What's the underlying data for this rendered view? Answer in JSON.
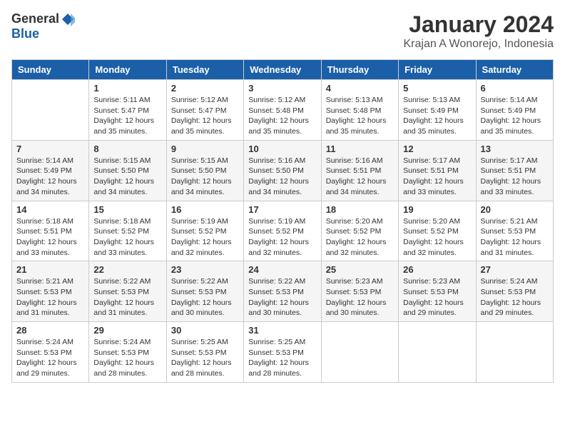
{
  "logo": {
    "general": "General",
    "blue": "Blue"
  },
  "title": "January 2024",
  "subtitle": "Krajan A Wonorejo, Indonesia",
  "days_header": [
    "Sunday",
    "Monday",
    "Tuesday",
    "Wednesday",
    "Thursday",
    "Friday",
    "Saturday"
  ],
  "weeks": [
    [
      {
        "day": "",
        "info": ""
      },
      {
        "day": "1",
        "info": "Sunrise: 5:11 AM\nSunset: 5:47 PM\nDaylight: 12 hours\nand 35 minutes."
      },
      {
        "day": "2",
        "info": "Sunrise: 5:12 AM\nSunset: 5:47 PM\nDaylight: 12 hours\nand 35 minutes."
      },
      {
        "day": "3",
        "info": "Sunrise: 5:12 AM\nSunset: 5:48 PM\nDaylight: 12 hours\nand 35 minutes."
      },
      {
        "day": "4",
        "info": "Sunrise: 5:13 AM\nSunset: 5:48 PM\nDaylight: 12 hours\nand 35 minutes."
      },
      {
        "day": "5",
        "info": "Sunrise: 5:13 AM\nSunset: 5:49 PM\nDaylight: 12 hours\nand 35 minutes."
      },
      {
        "day": "6",
        "info": "Sunrise: 5:14 AM\nSunset: 5:49 PM\nDaylight: 12 hours\nand 35 minutes."
      }
    ],
    [
      {
        "day": "7",
        "info": "Sunrise: 5:14 AM\nSunset: 5:49 PM\nDaylight: 12 hours\nand 34 minutes."
      },
      {
        "day": "8",
        "info": "Sunrise: 5:15 AM\nSunset: 5:50 PM\nDaylight: 12 hours\nand 34 minutes."
      },
      {
        "day": "9",
        "info": "Sunrise: 5:15 AM\nSunset: 5:50 PM\nDaylight: 12 hours\nand 34 minutes."
      },
      {
        "day": "10",
        "info": "Sunrise: 5:16 AM\nSunset: 5:50 PM\nDaylight: 12 hours\nand 34 minutes."
      },
      {
        "day": "11",
        "info": "Sunrise: 5:16 AM\nSunset: 5:51 PM\nDaylight: 12 hours\nand 34 minutes."
      },
      {
        "day": "12",
        "info": "Sunrise: 5:17 AM\nSunset: 5:51 PM\nDaylight: 12 hours\nand 33 minutes."
      },
      {
        "day": "13",
        "info": "Sunrise: 5:17 AM\nSunset: 5:51 PM\nDaylight: 12 hours\nand 33 minutes."
      }
    ],
    [
      {
        "day": "14",
        "info": "Sunrise: 5:18 AM\nSunset: 5:51 PM\nDaylight: 12 hours\nand 33 minutes."
      },
      {
        "day": "15",
        "info": "Sunrise: 5:18 AM\nSunset: 5:52 PM\nDaylight: 12 hours\nand 33 minutes."
      },
      {
        "day": "16",
        "info": "Sunrise: 5:19 AM\nSunset: 5:52 PM\nDaylight: 12 hours\nand 32 minutes."
      },
      {
        "day": "17",
        "info": "Sunrise: 5:19 AM\nSunset: 5:52 PM\nDaylight: 12 hours\nand 32 minutes."
      },
      {
        "day": "18",
        "info": "Sunrise: 5:20 AM\nSunset: 5:52 PM\nDaylight: 12 hours\nand 32 minutes."
      },
      {
        "day": "19",
        "info": "Sunrise: 5:20 AM\nSunset: 5:52 PM\nDaylight: 12 hours\nand 32 minutes."
      },
      {
        "day": "20",
        "info": "Sunrise: 5:21 AM\nSunset: 5:53 PM\nDaylight: 12 hours\nand 31 minutes."
      }
    ],
    [
      {
        "day": "21",
        "info": "Sunrise: 5:21 AM\nSunset: 5:53 PM\nDaylight: 12 hours\nand 31 minutes."
      },
      {
        "day": "22",
        "info": "Sunrise: 5:22 AM\nSunset: 5:53 PM\nDaylight: 12 hours\nand 31 minutes."
      },
      {
        "day": "23",
        "info": "Sunrise: 5:22 AM\nSunset: 5:53 PM\nDaylight: 12 hours\nand 30 minutes."
      },
      {
        "day": "24",
        "info": "Sunrise: 5:22 AM\nSunset: 5:53 PM\nDaylight: 12 hours\nand 30 minutes."
      },
      {
        "day": "25",
        "info": "Sunrise: 5:23 AM\nSunset: 5:53 PM\nDaylight: 12 hours\nand 30 minutes."
      },
      {
        "day": "26",
        "info": "Sunrise: 5:23 AM\nSunset: 5:53 PM\nDaylight: 12 hours\nand 29 minutes."
      },
      {
        "day": "27",
        "info": "Sunrise: 5:24 AM\nSunset: 5:53 PM\nDaylight: 12 hours\nand 29 minutes."
      }
    ],
    [
      {
        "day": "28",
        "info": "Sunrise: 5:24 AM\nSunset: 5:53 PM\nDaylight: 12 hours\nand 29 minutes."
      },
      {
        "day": "29",
        "info": "Sunrise: 5:24 AM\nSunset: 5:53 PM\nDaylight: 12 hours\nand 28 minutes."
      },
      {
        "day": "30",
        "info": "Sunrise: 5:25 AM\nSunset: 5:53 PM\nDaylight: 12 hours\nand 28 minutes."
      },
      {
        "day": "31",
        "info": "Sunrise: 5:25 AM\nSunset: 5:53 PM\nDaylight: 12 hours\nand 28 minutes."
      },
      {
        "day": "",
        "info": ""
      },
      {
        "day": "",
        "info": ""
      },
      {
        "day": "",
        "info": ""
      }
    ]
  ]
}
